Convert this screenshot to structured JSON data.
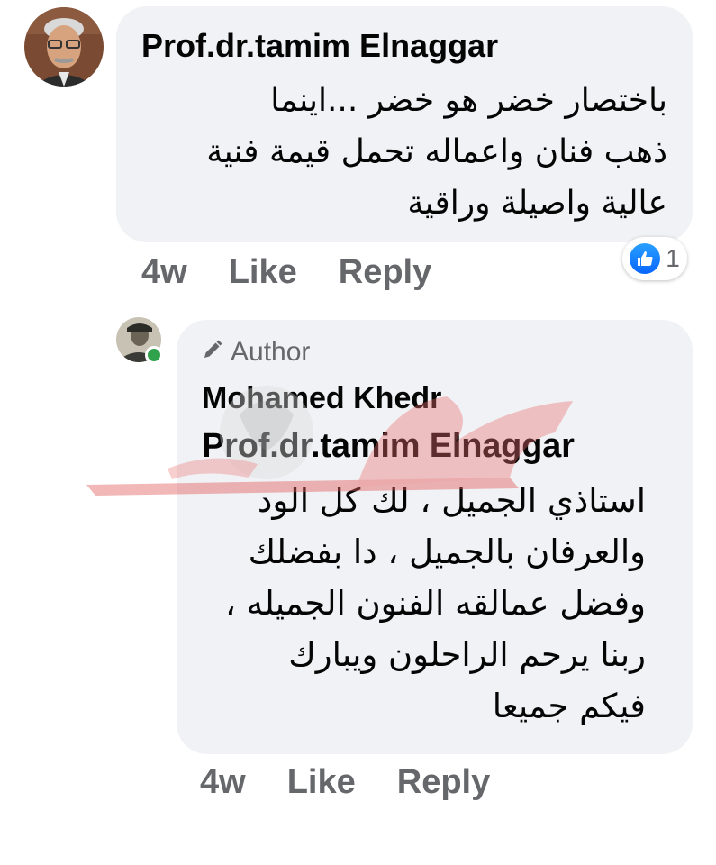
{
  "comments": [
    {
      "author": "Prof.dr.tamim Elnaggar",
      "text_lines": [
        "باختصار خضر هو خضر ...اينما",
        "ذهب فنان واعماله تحمل قيمة فنية",
        "عالية واصيلة وراقية"
      ],
      "time": "4w",
      "like_label": "Like",
      "reply_label": "Reply",
      "reaction_count": "1",
      "reaction_icon": "like-thumb-icon"
    }
  ],
  "reply": {
    "badge_icon": "pencil-icon",
    "badge_label": "Author",
    "author": "Mohamed Khedr",
    "mention": "Prof.dr.tamim Elnaggar",
    "text_lines": [
      "استاذي الجميل ، لك كل الود",
      "والعرفان بالجميل ، دا بفضلك",
      "وفضل عمالقه الفنون الجميله ،",
      "ربنا يرحم الراحلون ويبارك",
      "فيكم جميعا"
    ],
    "time": "4w",
    "like_label": "Like",
    "reply_label": "Reply",
    "online_status_color": "#31a24c"
  },
  "colors": {
    "bubble": "#f0f2f5",
    "meta_text": "#65676b",
    "like_blue": "#0866ff"
  }
}
